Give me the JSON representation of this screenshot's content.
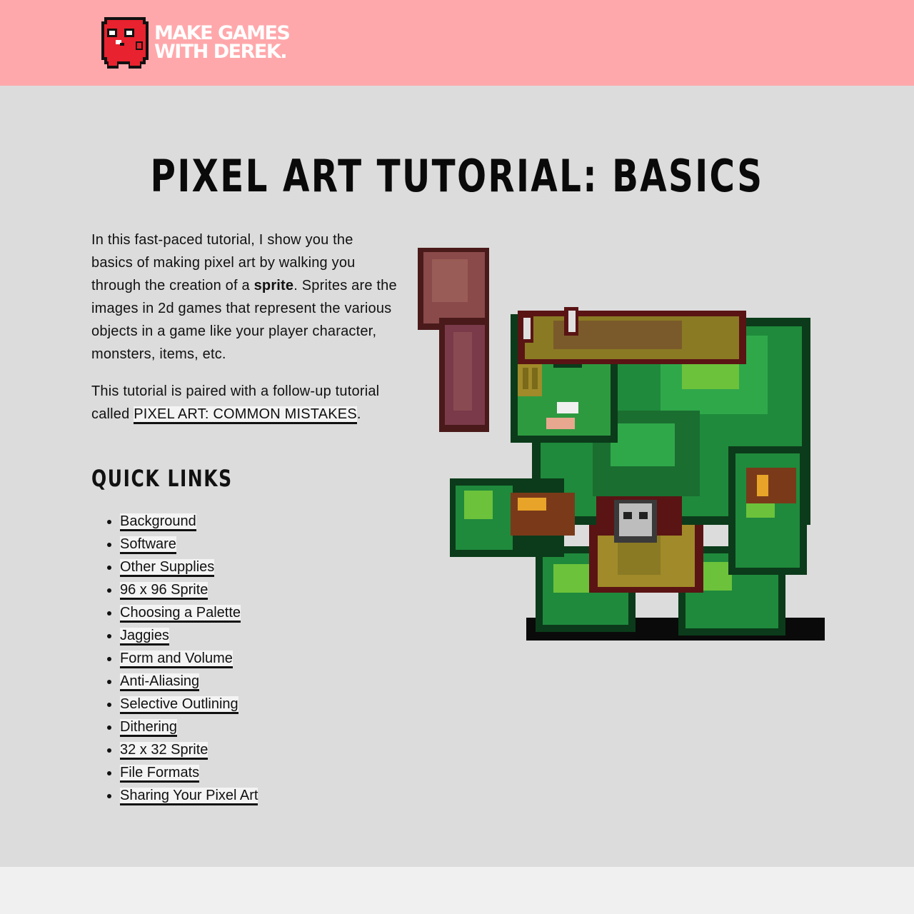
{
  "header": {
    "logo_line1": "MAKE GAMES",
    "logo_line2": "WITH DEREK.",
    "background_color": "#ffa8ab"
  },
  "page": {
    "title": "PIXEL ART TUTORIAL: BASICS",
    "intro_part1": "In this fast-paced tutorial, I show you the basics of making pixel art by walking you through the creation of a ",
    "intro_bold": "sprite",
    "intro_part2": ". Sprites are the images in 2d games that represent the various objects in a game like your player character, monsters, items, etc.",
    "followup_part1": "This tutorial is paired with a follow-up tutorial called ",
    "followup_link": "PIXEL ART: COMMON MISTAKES",
    "followup_part2": "."
  },
  "quick_links": {
    "heading": "QUICK LINKS",
    "items": [
      "Background",
      "Software",
      "Other Supplies",
      "96 x 96 Sprite",
      "Choosing a Palette",
      "Jaggies",
      "Form and Volume",
      "Anti-Aliasing",
      "Selective Outlining",
      "Dithering",
      "32 x 32 Sprite",
      "File Formats",
      "Sharing Your Pixel Art"
    ]
  },
  "colors": {
    "main_background": "#dcdcdc",
    "orc_green": "#2e8b3a",
    "orc_light_green": "#6cc23a",
    "club_brown": "#8b4a4a"
  },
  "icons": {
    "logo_mascot": "red-blob-mascot-icon",
    "sprite": "orc-with-club-pixel-art"
  }
}
